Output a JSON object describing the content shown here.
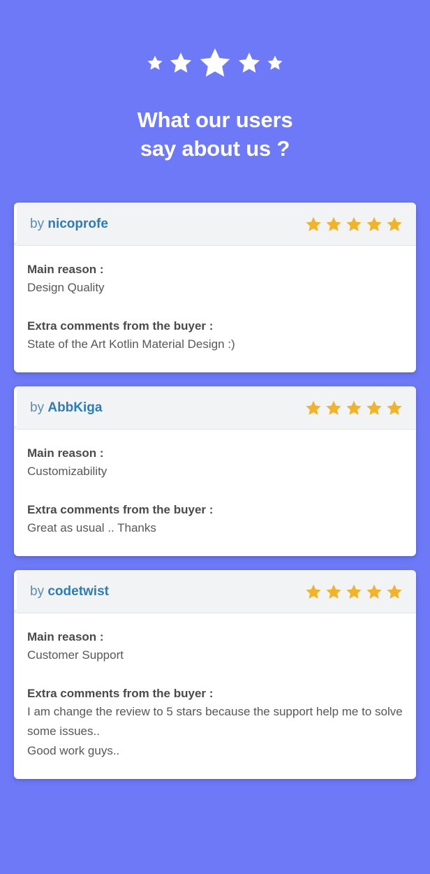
{
  "page": {
    "background_color": "#6d79f7",
    "star_color": "#efb42b",
    "hero_star_color": "#ffffff",
    "handle_color": "#2f7cb4",
    "by_color": "#5a8cba"
  },
  "hero": {
    "title_line_1": "What our users",
    "title_line_2": "say about us ?",
    "stars": [
      {
        "name": "hero-star-1",
        "size": "small"
      },
      {
        "name": "hero-star-2",
        "size": "medium"
      },
      {
        "name": "hero-star-3",
        "size": "large"
      },
      {
        "name": "hero-star-4",
        "size": "medium"
      },
      {
        "name": "hero-star-5",
        "size": "small"
      }
    ]
  },
  "labels": {
    "by_prefix": "by",
    "main_reason": "Main reason :",
    "extra_comments": "Extra comments from the buyer :"
  },
  "reviews": [
    {
      "handle": "nicoprofe",
      "rating": 5,
      "rating_icon": "star-icon",
      "main_reason": "Design Quality",
      "comment_lines": [
        "State of the Art Kotlin Material Design :)"
      ]
    },
    {
      "handle": "AbbKiga",
      "rating": 5,
      "rating_icon": "star-icon",
      "main_reason": "Customizability",
      "comment_lines": [
        "Great as usual .. Thanks"
      ]
    },
    {
      "handle": "codetwist",
      "rating": 5,
      "rating_icon": "star-icon",
      "main_reason": "Customer Support",
      "comment_lines": [
        "I am change the review to 5 stars because the support help me to solve some issues..",
        "Good work guys.."
      ]
    }
  ]
}
